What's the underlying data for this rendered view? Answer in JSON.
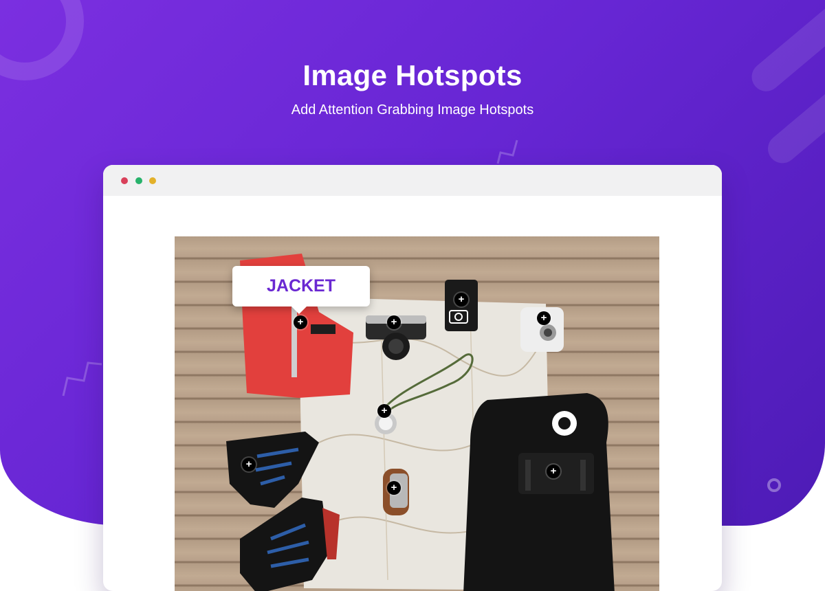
{
  "header": {
    "title": "Image Hotspots",
    "subtitle": "Add Attention Grabbing Image Hotspots"
  },
  "colors": {
    "brand_purple": "#6a28d2",
    "gradient_start": "#7b2fe0",
    "gradient_end": "#4d1bb6",
    "dot_red": "#d9405a",
    "dot_green": "#27b26b",
    "dot_yellow": "#e3b12a"
  },
  "browser": {
    "window_controls": [
      "close-dot",
      "minimize-dot",
      "maximize-dot"
    ]
  },
  "hotspots": {
    "marker_glyph": "+",
    "active_tooltip": "JACKET",
    "items": [
      "jacket",
      "camera",
      "notebook",
      "instant-camera",
      "compass",
      "boot",
      "multitool",
      "backpack"
    ]
  }
}
